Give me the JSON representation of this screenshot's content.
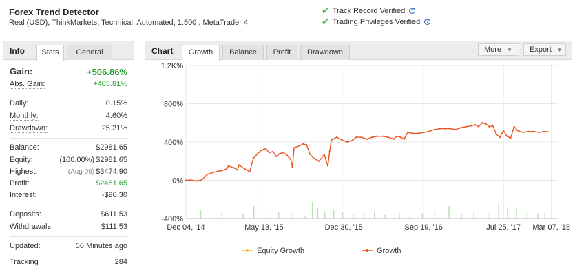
{
  "header": {
    "title": "Forex Trend Detector",
    "account_prefix": "Real (USD), ",
    "broker": "ThinkMarkets",
    "account_suffix": ", Technical, Automated, 1:500 , MetaTrader 4",
    "verified": [
      {
        "label": "Track Record Verified"
      },
      {
        "label": "Trading Privileges Verified"
      }
    ]
  },
  "info": {
    "tabs": [
      "Info",
      "Stats",
      "General"
    ],
    "gain": {
      "label": "Gain:",
      "value": "+506.86%"
    },
    "abs_gain": {
      "label": "Abs. Gain:",
      "value": "+405.81%"
    },
    "daily": {
      "label": "Daily:",
      "value": "0.15%"
    },
    "monthly": {
      "label": "Monthly:",
      "value": "4.60%"
    },
    "drawdown": {
      "label": "Drawdown:",
      "value": "25.21%"
    },
    "balance": {
      "label": "Balance:",
      "value": "$2981.65"
    },
    "equity": {
      "label": "Equity:",
      "note": "(100.00%)",
      "value": "$2981.65"
    },
    "highest": {
      "label": "Highest:",
      "note": "(Aug 09)",
      "value": "$3474.90"
    },
    "profit": {
      "label": "Profit:",
      "value": "$2481.65"
    },
    "interest": {
      "label": "Interest:",
      "value": "-$90.30"
    },
    "deposits": {
      "label": "Deposits:",
      "value": "$611.53"
    },
    "withdrawals": {
      "label": "Withdrawals:",
      "value": "$111.53"
    },
    "updated": {
      "label": "Updated:",
      "value": "56 Minutes ago"
    },
    "tracking": {
      "label": "Tracking",
      "value": "284"
    }
  },
  "chart_panel": {
    "tabs": [
      "Chart",
      "Growth",
      "Balance",
      "Profit",
      "Drawdown"
    ],
    "more_label": "More",
    "export_label": "Export"
  },
  "chart_data": {
    "type": "line",
    "x_tick_labels": [
      "Dec 04, '14",
      "May 13, '15",
      "Dec 30, '15",
      "Sep 19, '16",
      "Jul 25, '17",
      "Mar 07, '18"
    ],
    "y_tick_labels": [
      "1.2K%",
      "800%",
      "400%",
      "0%",
      "-400%"
    ],
    "ylim": [
      -400,
      1200
    ],
    "legend": [
      "Equity Growth",
      "Growth"
    ],
    "colors": {
      "growth": "#e8531f",
      "equity": "#f2c029",
      "volume": "#b9dfb3"
    },
    "series": [
      {
        "name": "Growth",
        "points": [
          [
            0,
            0
          ],
          [
            0.03,
            2
          ],
          [
            0.06,
            -8
          ],
          [
            0.09,
            5
          ],
          [
            0.12,
            60
          ],
          [
            0.15,
            80
          ],
          [
            0.18,
            95
          ],
          [
            0.2,
            100
          ],
          [
            0.23,
            120
          ],
          [
            0.24,
            150
          ],
          [
            0.27,
            130
          ],
          [
            0.29,
            110
          ],
          [
            0.3,
            160
          ],
          [
            0.33,
            120
          ],
          [
            0.36,
            90
          ],
          [
            0.38,
            230
          ],
          [
            0.41,
            290
          ],
          [
            0.43,
            320
          ],
          [
            0.45,
            330
          ],
          [
            0.47,
            290
          ],
          [
            0.49,
            300
          ],
          [
            0.51,
            250
          ],
          [
            0.53,
            280
          ],
          [
            0.55,
            290
          ],
          [
            0.57,
            260
          ],
          [
            0.59,
            220
          ],
          [
            0.6,
            140
          ],
          [
            0.61,
            340
          ],
          [
            0.64,
            360
          ],
          [
            0.66,
            380
          ],
          [
            0.68,
            370
          ],
          [
            0.7,
            270
          ],
          [
            0.72,
            230
          ],
          [
            0.75,
            200
          ],
          [
            0.78,
            270
          ],
          [
            0.8,
            150
          ],
          [
            0.81,
            300
          ],
          [
            0.82,
            420
          ],
          [
            0.85,
            450
          ],
          [
            0.88,
            420
          ],
          [
            0.91,
            400
          ],
          [
            0.94,
            420
          ],
          [
            0.96,
            450
          ],
          [
            0.99,
            450
          ],
          [
            1.02,
            430
          ],
          [
            1.05,
            450
          ],
          [
            1.08,
            460
          ],
          [
            1.11,
            460
          ],
          [
            1.14,
            450
          ],
          [
            1.17,
            430
          ],
          [
            1.19,
            460
          ],
          [
            1.21,
            450
          ],
          [
            1.23,
            430
          ],
          [
            1.25,
            500
          ],
          [
            1.28,
            490
          ],
          [
            1.31,
            490
          ],
          [
            1.34,
            500
          ],
          [
            1.37,
            510
          ],
          [
            1.4,
            530
          ],
          [
            1.43,
            540
          ],
          [
            1.46,
            540
          ],
          [
            1.49,
            540
          ],
          [
            1.52,
            530
          ],
          [
            1.55,
            550
          ],
          [
            1.58,
            560
          ],
          [
            1.61,
            570
          ],
          [
            1.63,
            580
          ],
          [
            1.65,
            560
          ],
          [
            1.67,
            600
          ],
          [
            1.69,
            590
          ],
          [
            1.71,
            560
          ],
          [
            1.73,
            570
          ],
          [
            1.75,
            480
          ],
          [
            1.77,
            450
          ],
          [
            1.79,
            520
          ],
          [
            1.81,
            460
          ],
          [
            1.83,
            440
          ],
          [
            1.85,
            560
          ],
          [
            1.87,
            520
          ],
          [
            1.9,
            500
          ],
          [
            1.93,
            510
          ],
          [
            1.96,
            510
          ],
          [
            1.99,
            500
          ],
          [
            2.02,
            510
          ],
          [
            2.04,
            506.86
          ]
        ]
      }
    ],
    "volume_bars": [
      [
        0.08,
        40
      ],
      [
        0.2,
        28
      ],
      [
        0.32,
        22
      ],
      [
        0.38,
        60
      ],
      [
        0.45,
        18
      ],
      [
        0.52,
        30
      ],
      [
        0.6,
        25
      ],
      [
        0.67,
        15
      ],
      [
        0.71,
        80
      ],
      [
        0.74,
        50
      ],
      [
        0.78,
        35
      ],
      [
        0.83,
        45
      ],
      [
        0.88,
        30
      ],
      [
        0.94,
        20
      ],
      [
        1.0,
        22
      ],
      [
        1.06,
        35
      ],
      [
        1.12,
        18
      ],
      [
        1.2,
        28
      ],
      [
        1.26,
        15
      ],
      [
        1.33,
        25
      ],
      [
        1.4,
        40
      ],
      [
        1.48,
        60
      ],
      [
        1.55,
        20
      ],
      [
        1.62,
        30
      ],
      [
        1.7,
        25
      ],
      [
        1.76,
        75
      ],
      [
        1.81,
        55
      ],
      [
        1.86,
        50
      ],
      [
        1.92,
        30
      ],
      [
        1.98,
        20
      ],
      [
        2.02,
        25
      ]
    ]
  }
}
